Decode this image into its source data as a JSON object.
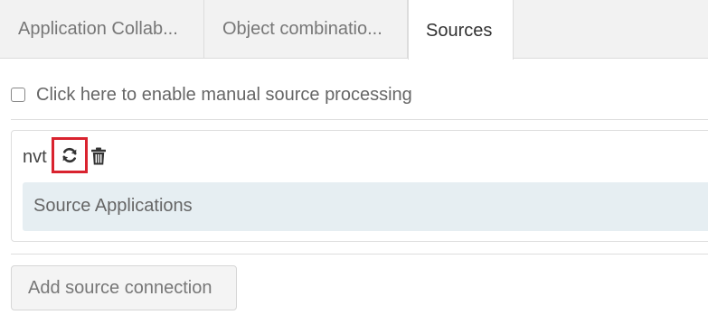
{
  "tabs": [
    {
      "label": "Application Collab..."
    },
    {
      "label": "Object combinatio..."
    },
    {
      "label": "Sources"
    }
  ],
  "active_tab": "Sources",
  "manual_processing": {
    "label": "Click here to enable manual source processing",
    "checked": false
  },
  "source": {
    "name": "nvt",
    "refresh_icon": "refresh-icon",
    "delete_icon": "trash-icon",
    "applications_header": "Source Applications"
  },
  "add_connection_label": "Add source connection",
  "colors": {
    "highlight": "#d9232f",
    "apps_header_bg": "#e6eef2",
    "tabbar_bg": "#f2f2f2"
  }
}
